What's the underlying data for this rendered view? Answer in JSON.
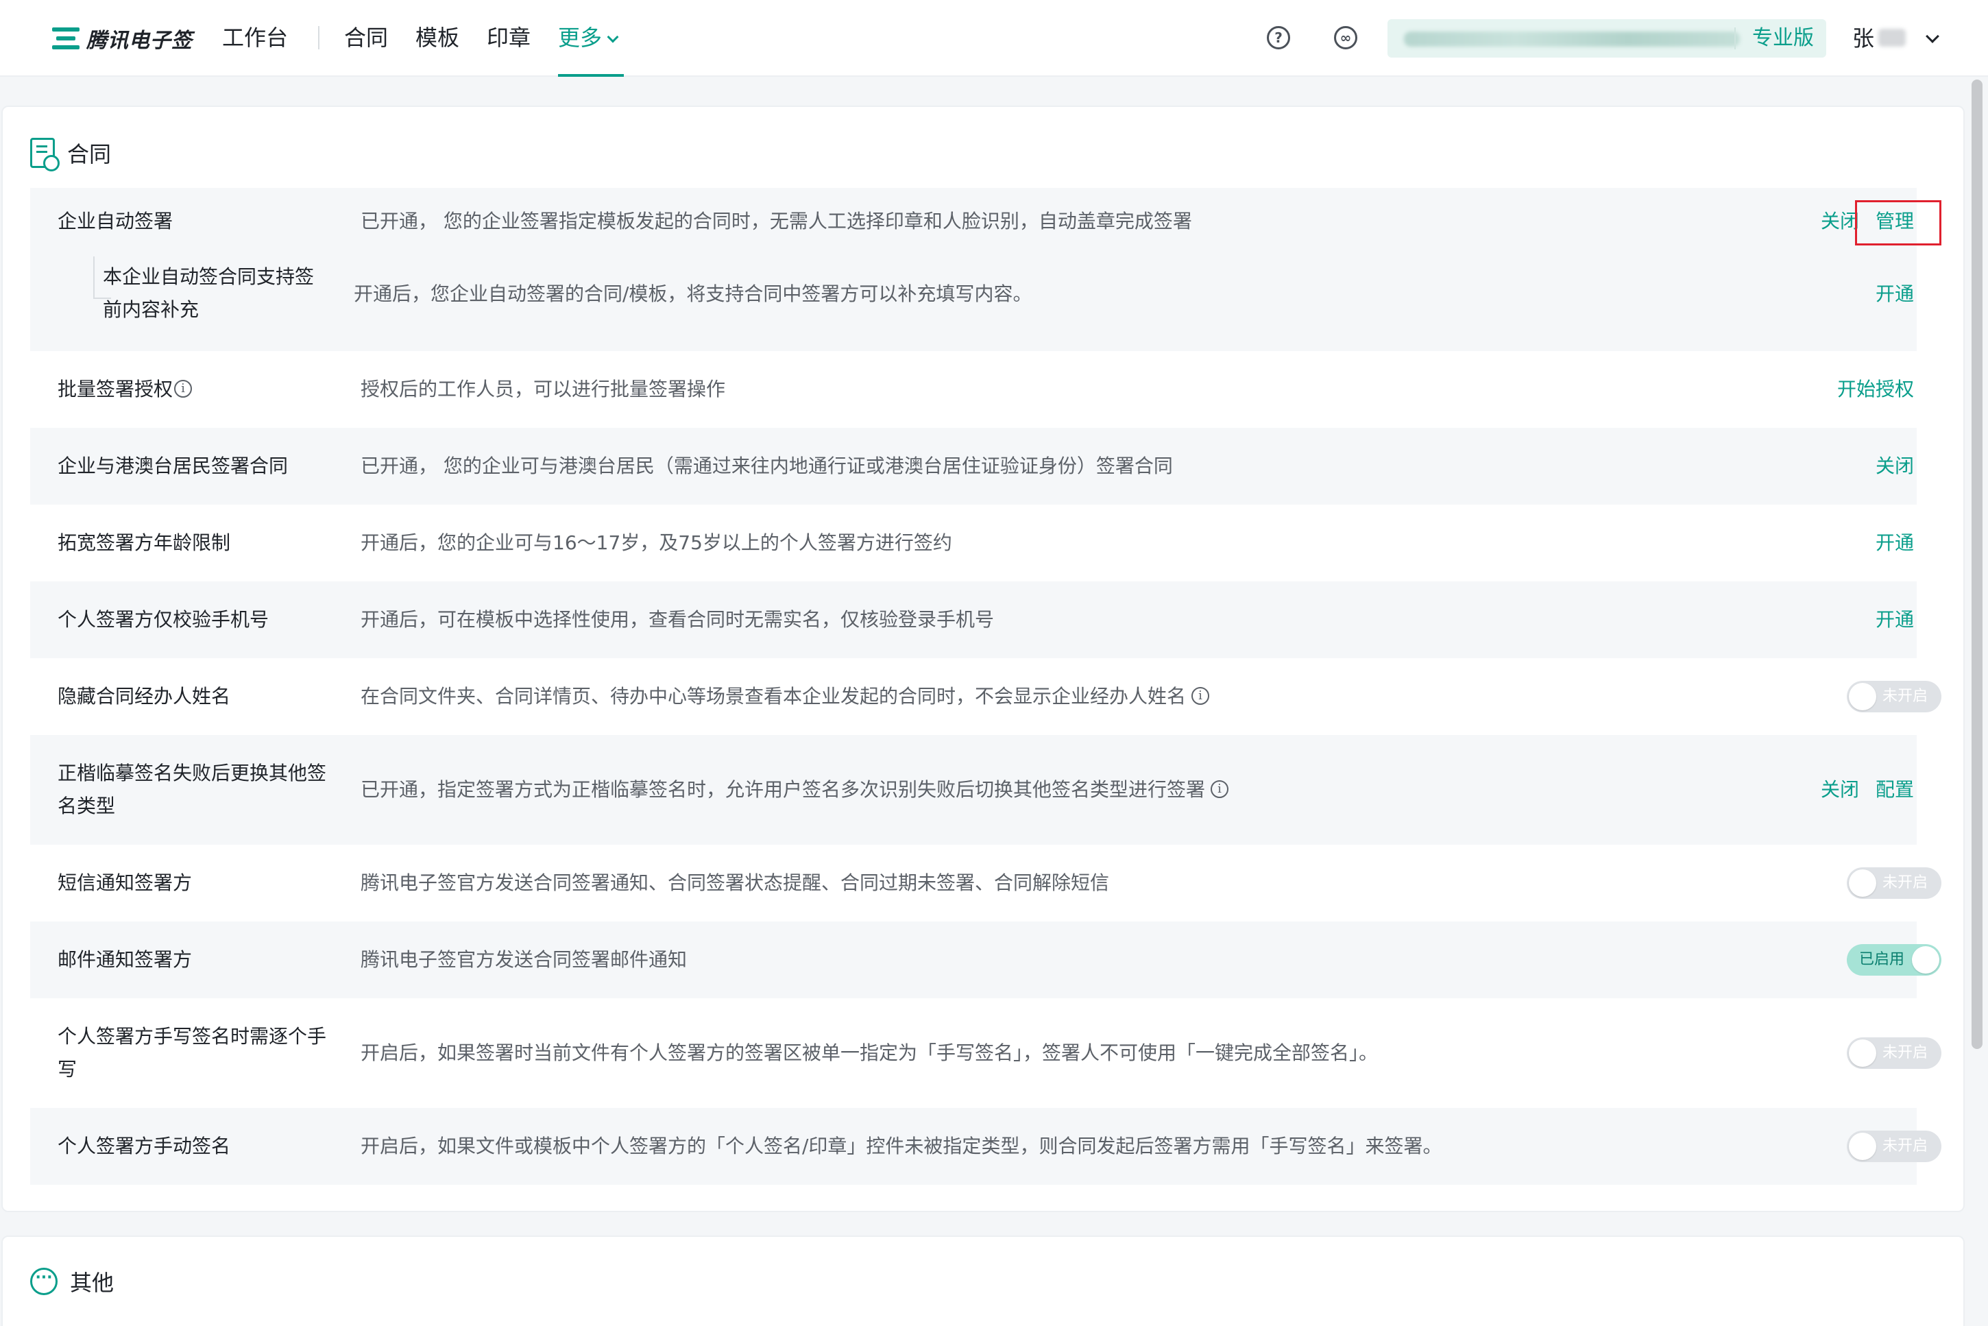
{
  "colors": {
    "accent": "#0a9e8b",
    "highlight": "#e0202e",
    "row_shade": "#f5f7f9"
  },
  "header": {
    "brand": "腾讯电子签",
    "nav": [
      "工作台",
      "合同",
      "模板",
      "印章"
    ],
    "more": "更多",
    "icons": [
      "help-icon",
      "link-icon"
    ],
    "account_edition": "专业版",
    "user_name": "张"
  },
  "contract_section": {
    "title": "合同",
    "icon": "contract-doc-icon",
    "rows": [
      {
        "label": "企业自动签署",
        "desc": "已开通， 您的企业签署指定模板发起的合同时，无需人工选择印章和人脸识别，自动盖章完成签署",
        "actions": [
          "关闭",
          "管理"
        ]
      },
      {
        "label": "本企业自动签合同支持签前内容补充",
        "desc": "开通后，您企业自动签署的合同/模板，将支持合同中签署方可以补充填写内容。",
        "actions": [
          "开通"
        ]
      },
      {
        "label": "批量签署授权",
        "desc": "授权后的工作人员，可以进行批量签署操作",
        "actions": [
          "开始授权"
        ]
      },
      {
        "label": "企业与港澳台居民签署合同",
        "desc": "已开通， 您的企业可与港澳台居民（需通过来往内地通行证或港澳台居住证验证身份）签署合同",
        "actions": [
          "关闭"
        ]
      },
      {
        "label": "拓宽签署方年龄限制",
        "desc": "开通后，您的企业可与16～17岁，及75岁以上的个人签署方进行签约",
        "actions": [
          "开通"
        ]
      },
      {
        "label": "个人签署方仅校验手机号",
        "desc": "开通后，可在模板中选择性使用，查看合同时无需实名，仅核验登录手机号",
        "actions": [
          "开通"
        ]
      },
      {
        "label": "隐藏合同经办人姓名",
        "desc": "在合同文件夹、合同详情页、待办中心等场景查看本企业发起的合同时，不会显示企业经办人姓名",
        "toggle": {
          "on": false,
          "label": "未开启"
        }
      },
      {
        "label": "正楷临摹签名失败后更换其他签名类型",
        "desc": "已开通，指定签署方式为正楷临摹签名时，允许用户签名多次识别失败后切换其他签名类型进行签署",
        "actions": [
          "关闭",
          "配置"
        ]
      },
      {
        "label": "短信通知签署方",
        "desc": "腾讯电子签官方发送合同签署通知、合同签署状态提醒、合同过期未签署、合同解除短信",
        "toggle": {
          "on": false,
          "label": "未开启"
        }
      },
      {
        "label": "邮件通知签署方",
        "desc": "腾讯电子签官方发送合同签署邮件通知",
        "toggle": {
          "on": true,
          "label": "已启用"
        }
      },
      {
        "label": "个人签署方手写签名时需逐个手写",
        "desc": "开启后，如果签署时当前文件有个人签署方的签署区被单一指定为「手写签名」，签署人不可使用「一键完成全部签名」。",
        "toggle": {
          "on": false,
          "label": "未开启"
        }
      },
      {
        "label": "个人签署方手动签名",
        "desc": "开启后，如果文件或模板中个人签署方的「个人签名/印章」控件未被指定类型，则合同发起后签署方需用「手写签名」来签署。",
        "toggle": {
          "on": false,
          "label": "未开启"
        }
      }
    ]
  },
  "other_section": {
    "title": "其他",
    "icon": "more-dots-icon"
  }
}
